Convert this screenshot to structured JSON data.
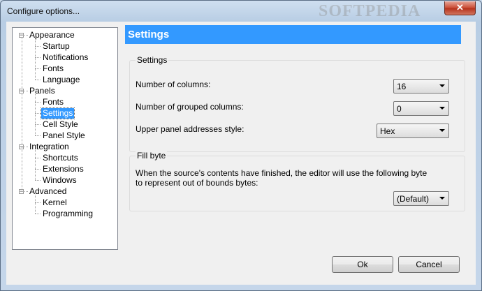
{
  "window": {
    "title": "Configure options...",
    "watermark": "SOFTPEDIA",
    "close_glyph": "✕"
  },
  "tree": {
    "items": [
      {
        "label": "Appearance",
        "level": 0,
        "expanded": true
      },
      {
        "label": "Startup",
        "level": 1
      },
      {
        "label": "Notifications",
        "level": 1
      },
      {
        "label": "Fonts",
        "level": 1
      },
      {
        "label": "Language",
        "level": 1
      },
      {
        "label": "Panels",
        "level": 0,
        "expanded": true
      },
      {
        "label": "Fonts",
        "level": 1
      },
      {
        "label": "Settings",
        "level": 1,
        "selected": true
      },
      {
        "label": "Cell Style",
        "level": 1
      },
      {
        "label": "Panel Style",
        "level": 1
      },
      {
        "label": "Integration",
        "level": 0,
        "expanded": true
      },
      {
        "label": "Shortcuts",
        "level": 1
      },
      {
        "label": "Extensions",
        "level": 1
      },
      {
        "label": "Windows",
        "level": 1
      },
      {
        "label": "Advanced",
        "level": 0,
        "expanded": true
      },
      {
        "label": "Kernel",
        "level": 1
      },
      {
        "label": "Programming",
        "level": 1
      }
    ],
    "collapse_glyph": "−"
  },
  "header": {
    "title": "Settings",
    "color": "#3399ff"
  },
  "settings_group": {
    "title": "Settings",
    "columns_label": "Number of columns:",
    "columns_value": "16",
    "grouped_label": "Number of grouped columns:",
    "grouped_value": "0",
    "address_label": "Upper panel addresses style:",
    "address_value": "Hex"
  },
  "fill_group": {
    "title": "Fill byte",
    "description_line1": "When the source's contents have finished, the editor will use the following byte",
    "description_line2": "to represent out of bounds bytes:",
    "value": "(Default)"
  },
  "buttons": {
    "ok": "Ok",
    "cancel": "Cancel"
  }
}
